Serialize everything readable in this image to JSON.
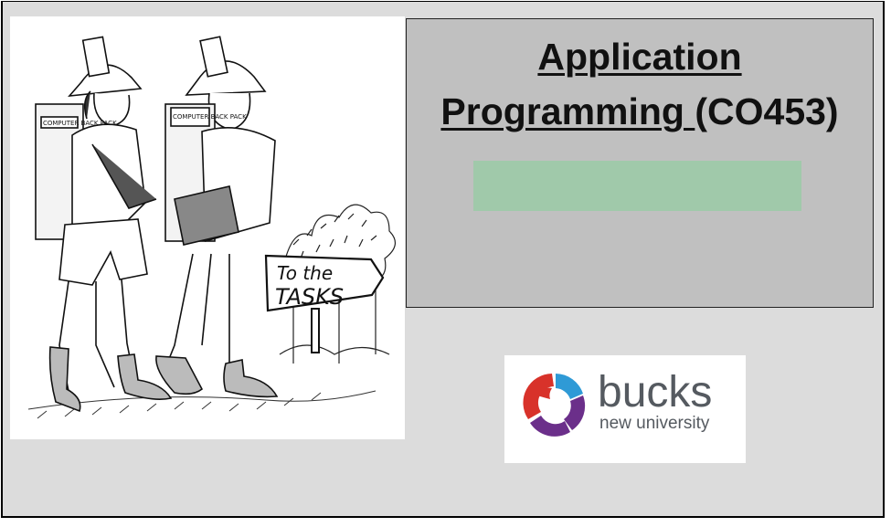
{
  "title": {
    "line1": "Application",
    "line2_underlined": "Programming ",
    "line2_rest": "(CO453)"
  },
  "cartoon": {
    "sign_line1": "To the",
    "sign_line2": "TASKS",
    "backpack_left": "COMPUTER BACK PACK",
    "backpack_right": "COMPUTER BACK PACK"
  },
  "logo": {
    "word": "bucks",
    "subtitle": "new university"
  },
  "colors": {
    "background": "#dcdcdc",
    "title_box": "#c0c0c0",
    "accent_bar": "#a0c9aa",
    "logo_red": "#d8322a",
    "logo_purple": "#6b2f8a",
    "logo_blue": "#2f9ad6"
  }
}
